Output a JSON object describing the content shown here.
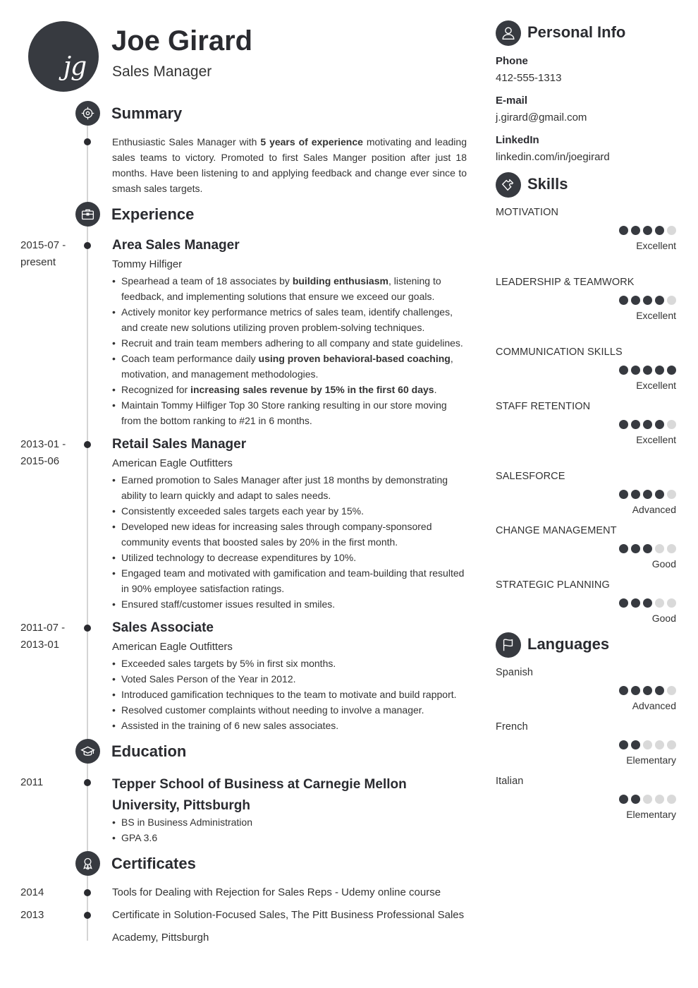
{
  "header": {
    "initials": "jg",
    "name": "Joe Girard",
    "role": "Sales Manager"
  },
  "icons": {
    "summary": "target-icon",
    "experience": "briefcase-icon",
    "education": "graduation-cap-icon",
    "certificates": "award-ribbon-icon",
    "personal_info": "user-icon",
    "skills": "puzzle-icon",
    "languages": "flag-icon"
  },
  "colors": {
    "accent": "#373a40",
    "rating_empty": "#d9d9d9",
    "timeline": "#d5d5d5"
  },
  "summary": {
    "title": "Summary",
    "pre": "Enthusiastic Sales Manager with ",
    "bold": "5 years of experience",
    "post": " motivating and leading sales teams to victory. Promoted to first Sales Manger position after just 18 months. Have been listening to and applying feedback and change ever since to smash sales targets."
  },
  "experience": {
    "title": "Experience",
    "jobs": [
      {
        "date_start": "2015-07 -",
        "date_end": "present",
        "title": "Area Sales Manager",
        "company": "Tommy Hilfiger",
        "bullets": [
          {
            "pre": "Spearhead a team of 18 associates by ",
            "bold": "building enthusiasm",
            "post": ", listening to feedback, and implementing solutions that ensure we exceed our goals."
          },
          {
            "pre": "Actively monitor key performance metrics of sales team, identify challenges, and create new solutions utilizing proven problem-solving techniques.",
            "bold": "",
            "post": ""
          },
          {
            "pre": "Recruit and train team members adhering to all company and state guidelines.",
            "bold": "",
            "post": ""
          },
          {
            "pre": "Coach team performance daily ",
            "bold": "using proven behavioral-based coaching",
            "post": ", motivation, and management methodologies."
          },
          {
            "pre": "Recognized for ",
            "bold": "increasing sales revenue by 15% in the first 60 days",
            "post": "."
          },
          {
            "pre": "Maintain Tommy Hilfiger Top 30 Store ranking resulting in our store moving from the bottom ranking to #21 in 6 months.",
            "bold": "",
            "post": ""
          }
        ]
      },
      {
        "date_start": "2013-01 -",
        "date_end": "2015-06",
        "title": "Retail Sales Manager",
        "company": "American Eagle Outfitters",
        "bullets": [
          {
            "pre": "Earned promotion to Sales Manager after just 18 months by demonstrating ability to learn quickly and adapt to sales needs.",
            "bold": "",
            "post": ""
          },
          {
            "pre": "Consistently exceeded sales targets each year by 15%.",
            "bold": "",
            "post": ""
          },
          {
            "pre": "Developed new ideas for increasing sales through company-sponsored community events that boosted sales by 20% in the first month.",
            "bold": "",
            "post": ""
          },
          {
            "pre": "Utilized technology to decrease expenditures by 10%.",
            "bold": "",
            "post": ""
          },
          {
            "pre": "Engaged team and motivated with gamification and team-building that resulted in 90% employee satisfaction ratings.",
            "bold": "",
            "post": ""
          },
          {
            "pre": "Ensured staff/customer issues resulted in smiles.",
            "bold": "",
            "post": ""
          }
        ]
      },
      {
        "date_start": "2011-07 -",
        "date_end": "2013-01",
        "title": "Sales Associate",
        "company": "American Eagle Outfitters",
        "bullets": [
          {
            "pre": "Exceeded sales targets by 5% in first six months.",
            "bold": "",
            "post": ""
          },
          {
            "pre": "Voted Sales Person of the Year in 2012.",
            "bold": "",
            "post": ""
          },
          {
            "pre": "Introduced gamification techniques to the team to motivate and build rapport.",
            "bold": "",
            "post": ""
          },
          {
            "pre": "Resolved customer complaints without needing to involve a manager.",
            "bold": "",
            "post": ""
          },
          {
            "pre": "Assisted in the training of 6 new sales associates.",
            "bold": "",
            "post": ""
          }
        ]
      }
    ]
  },
  "education": {
    "title": "Education",
    "items": [
      {
        "date": "2011",
        "school_line1": "Tepper School of Business at Carnegie Mellon",
        "school_line2": "University, Pittsburgh",
        "bullets": [
          "BS in Business Administration",
          "GPA 3.6"
        ]
      }
    ]
  },
  "certificates": {
    "title": "Certificates",
    "items": [
      {
        "date": "2014",
        "text": "Tools for Dealing with Rejection for Sales Reps - Udemy online course"
      },
      {
        "date": "2013",
        "text": "Certificate in Solution-Focused Sales, The Pitt Business Professional Sales Academy, Pittsburgh"
      }
    ]
  },
  "personal_info": {
    "title": "Personal Info",
    "fields": [
      {
        "label": "Phone",
        "value": "412-555-1313"
      },
      {
        "label": "E-mail",
        "value": "j.girard@gmail.com"
      },
      {
        "label": "LinkedIn",
        "value": "linkedin.com/in/joegirard"
      }
    ]
  },
  "skills": {
    "title": "Skills",
    "items": [
      {
        "name": "MOTIVATION",
        "rating": 4,
        "max": 5,
        "level": "Excellent"
      },
      {
        "name": "LEADERSHIP & TEAMWORK",
        "rating": 4,
        "max": 5,
        "level": "Excellent"
      },
      {
        "name": "COMMUNICATION SKILLS",
        "rating": 5,
        "max": 5,
        "level": "Excellent"
      },
      {
        "name": "STAFF RETENTION",
        "rating": 4,
        "max": 5,
        "level": "Excellent"
      },
      {
        "name": "SALESFORCE",
        "rating": 4,
        "max": 5,
        "level": "Advanced"
      },
      {
        "name": "CHANGE MANAGEMENT",
        "rating": 3,
        "max": 5,
        "level": "Good"
      },
      {
        "name": "STRATEGIC PLANNING",
        "rating": 3,
        "max": 5,
        "level": "Good"
      }
    ]
  },
  "languages": {
    "title": "Languages",
    "items": [
      {
        "name": "Spanish",
        "rating": 4,
        "max": 5,
        "level": "Advanced"
      },
      {
        "name": "French",
        "rating": 2,
        "max": 5,
        "level": "Elementary"
      },
      {
        "name": "Italian",
        "rating": 2,
        "max": 5,
        "level": "Elementary"
      }
    ]
  }
}
